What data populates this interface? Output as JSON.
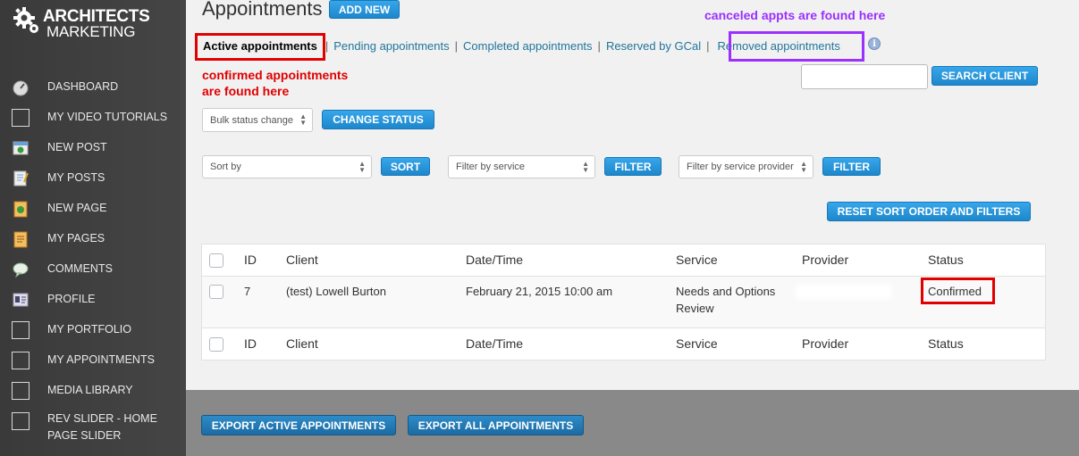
{
  "logo": {
    "line1": "ARCHITECTS",
    "line2": "MARKETING"
  },
  "sidebar": {
    "items": [
      {
        "label": "DASHBOARD",
        "icon": "dashboard-icon"
      },
      {
        "label": "MY VIDEO TUTORIALS",
        "icon": "blank-icon"
      },
      {
        "label": "NEW POST",
        "icon": "new-post-icon"
      },
      {
        "label": "MY POSTS",
        "icon": "posts-icon"
      },
      {
        "label": "NEW PAGE",
        "icon": "new-page-icon"
      },
      {
        "label": "MY PAGES",
        "icon": "pages-icon"
      },
      {
        "label": "COMMENTS",
        "icon": "comments-icon"
      },
      {
        "label": "PROFILE",
        "icon": "profile-icon"
      },
      {
        "label": "MY PORTFOLIO",
        "icon": "blank-icon"
      },
      {
        "label": "MY APPOINTMENTS",
        "icon": "blank-icon"
      },
      {
        "label": "MEDIA LIBRARY",
        "icon": "blank-icon"
      },
      {
        "label": "REV SLIDER - HOME PAGE SLIDER",
        "icon": "blank-icon"
      }
    ]
  },
  "header": {
    "title": "Appointments",
    "add_new": "ADD NEW"
  },
  "tabs": {
    "active": "Active appointments",
    "pending": "Pending appointments",
    "completed": "Completed appointments",
    "reserved": "Reserved by GCal",
    "removed": "Removed appointments"
  },
  "annotations": {
    "confirmed_line1": "confirmed appointments",
    "confirmed_line2": "are found here",
    "canceled": "canceled appts are found here"
  },
  "search": {
    "value": "",
    "button": "SEARCH CLIENT"
  },
  "bulk": {
    "select": "Bulk status change",
    "button": "CHANGE STATUS"
  },
  "filters": {
    "sort_select": "Sort by",
    "sort_button": "SORT",
    "service_select": "Filter by service",
    "service_button": "FILTER",
    "provider_select": "Filter by service provider",
    "provider_button": "FILTER",
    "reset": "RESET SORT ORDER AND FILTERS"
  },
  "table": {
    "columns": [
      "ID",
      "Client",
      "Date/Time",
      "Service",
      "Provider",
      "Status"
    ],
    "rows": [
      {
        "id": "7",
        "client": "(test) Lowell Burton",
        "datetime": "February 21, 2015 10:00 am",
        "service_line1": "Needs and Options",
        "service_line2": "Review",
        "provider": "",
        "status": "Confirmed"
      }
    ]
  },
  "footer": {
    "export_active": "EXPORT ACTIVE APPOINTMENTS",
    "export_all": "EXPORT ALL APPOINTMENTS"
  },
  "colors": {
    "accent": "#2196dd",
    "annotation_red": "#e00000",
    "annotation_purple": "#9b30ff",
    "sidebar": "#404040"
  }
}
